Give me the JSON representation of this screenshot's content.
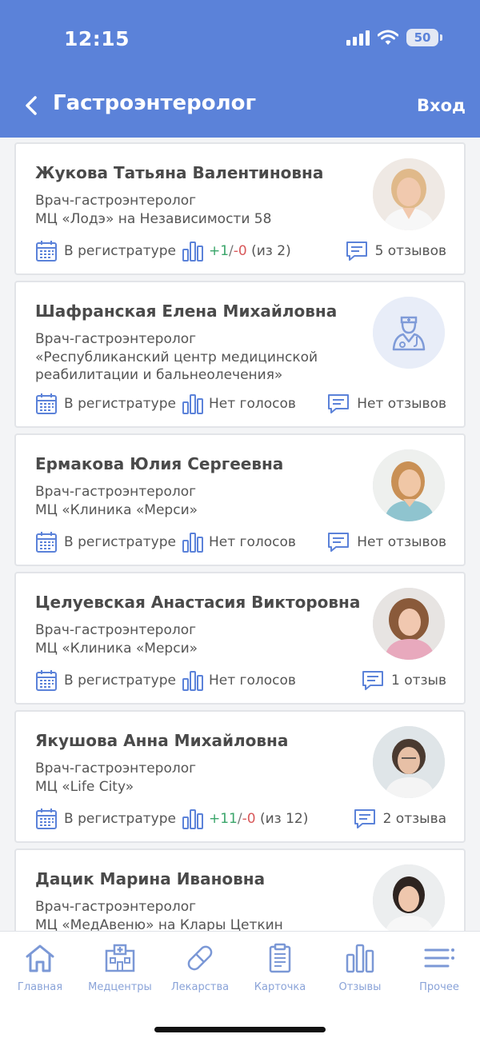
{
  "status_bar": {
    "time": "12:15",
    "battery": "50"
  },
  "header": {
    "title": "Гастроэнтеролог",
    "login": "Вход"
  },
  "doctors": [
    {
      "name": "Жукова Татьяна Валентиновна",
      "specialty": "Врач-гастроэнтеролог",
      "clinic": "МЦ «Лодэ» на Независимости 58",
      "registration": "В регистратуре",
      "votes_plus": "+1",
      "votes_minus": "-0",
      "votes_total": "(из 2)",
      "reviews": "5 отзывов"
    },
    {
      "name": "Шафранская Елена Михайловна",
      "specialty": "Врач-гастроэнтеролог",
      "clinic": "«Республиканский центр медицинской реабилитации и бальнеолечения»",
      "registration": "В регистратуре",
      "votes": "Нет голосов",
      "reviews": "Нет отзывов"
    },
    {
      "name": "Ермакова Юлия Сергеевна",
      "specialty": "Врач-гастроэнтеролог",
      "clinic": "МЦ «Клиника «Мерси»",
      "registration": "В регистратуре",
      "votes": "Нет голосов",
      "reviews": "Нет отзывов"
    },
    {
      "name": "Целуевская Анастасия Викторовна",
      "specialty": "Врач-гастроэнтеролог",
      "clinic": "МЦ «Клиника «Мерси»",
      "registration": "В регистратуре",
      "votes": "Нет голосов",
      "reviews": "1 отзыв"
    },
    {
      "name": "Якушова Анна Михайловна",
      "specialty": "Врач-гастроэнтеролог",
      "clinic": "МЦ «Life City»",
      "registration": "В регистратуре",
      "votes_plus": "+11",
      "votes_minus": "-0",
      "votes_total": "(из 12)",
      "reviews": "2 отзыва"
    },
    {
      "name": "Дацик Марина Ивановна",
      "specialty": "Врач-гастроэнтеролог",
      "clinic": "МЦ «МедАвеню» на Клары Цеткин"
    }
  ],
  "tabbar": [
    {
      "label": "Главная",
      "icon": "home-icon"
    },
    {
      "label": "Медцентры",
      "icon": "hospital-icon"
    },
    {
      "label": "Лекарства",
      "icon": "pill-icon"
    },
    {
      "label": "Карточка",
      "icon": "clipboard-icon"
    },
    {
      "label": "Отзывы",
      "icon": "bar-chart-icon"
    },
    {
      "label": "Прочее",
      "icon": "menu-icon"
    }
  ],
  "colors": {
    "header": "#5b82d9",
    "accent": "#5b82d9",
    "plus": "#3aa56a",
    "minus": "#d8585a"
  }
}
